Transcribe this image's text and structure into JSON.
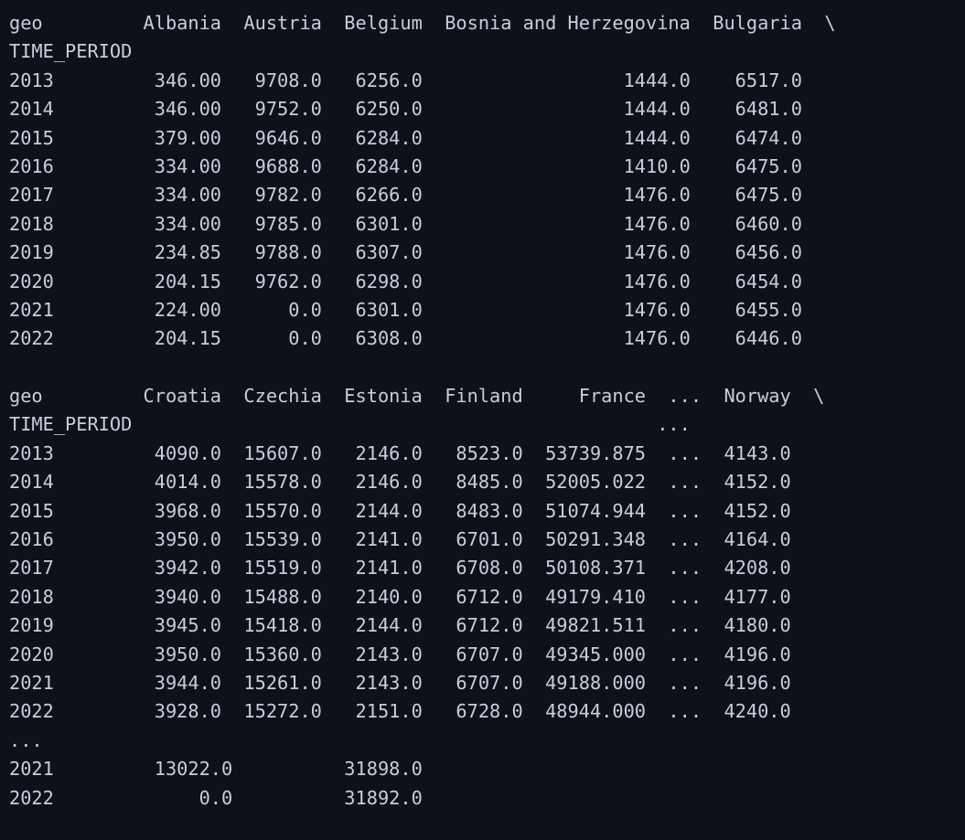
{
  "terminal": {
    "colors": {
      "background": "#0f111a",
      "text": "#c9cdd8"
    },
    "lines": [
      "geo         Albania  Austria  Belgium  Bosnia and Herzegovina  Bulgaria  \\",
      "TIME_PERIOD",
      "2013         346.00   9708.0   6256.0                  1444.0    6517.0",
      "2014         346.00   9752.0   6250.0                  1444.0    6481.0",
      "2015         379.00   9646.0   6284.0                  1444.0    6474.0",
      "2016         334.00   9688.0   6284.0                  1410.0    6475.0",
      "2017         334.00   9782.0   6266.0                  1476.0    6475.0",
      "2018         334.00   9785.0   6301.0                  1476.0    6460.0",
      "2019         234.85   9788.0   6307.0                  1476.0    6456.0",
      "2020         204.15   9762.0   6298.0                  1476.0    6454.0",
      "2021         224.00      0.0   6301.0                  1476.0    6455.0",
      "2022         204.15      0.0   6308.0                  1476.0    6446.0",
      "",
      "geo         Croatia  Czechia  Estonia  Finland     France  ...  Norway  \\",
      "TIME_PERIOD                                               ...",
      "2013         4090.0  15607.0   2146.0   8523.0  53739.875  ...  4143.0",
      "2014         4014.0  15578.0   2146.0   8485.0  52005.022  ...  4152.0",
      "2015         3968.0  15570.0   2144.0   8483.0  51074.944  ...  4152.0",
      "2016         3950.0  15539.0   2141.0   6701.0  50291.348  ...  4164.0",
      "2017         3942.0  15519.0   2141.0   6708.0  50108.371  ...  4208.0",
      "2018         3940.0  15488.0   2140.0   6712.0  49179.410  ...  4177.0",
      "2019         3945.0  15418.0   2144.0   6712.0  49821.511  ...  4180.0",
      "2020         3950.0  15360.0   2143.0   6707.0  49345.000  ...  4196.0",
      "2021         3944.0  15261.0   2143.0   6707.0  49188.000  ...  4196.0",
      "2022         3928.0  15272.0   2151.0   6728.0  48944.000  ...  4240.0",
      "...",
      "2021         13022.0          31898.0",
      "2022             0.0          31892.0"
    ]
  }
}
